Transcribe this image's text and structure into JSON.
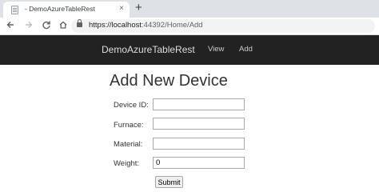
{
  "browser": {
    "tab_title": "- DemoAzureTableRest",
    "close_glyph": "×",
    "new_tab_glyph": "+",
    "url_host": "https://localhost",
    "url_rest": ":44392/Home/Add",
    "icons": [
      "back-arrow-icon",
      "forward-arrow-icon",
      "reload-icon",
      "home-icon",
      "lock-icon",
      "favicon-icon"
    ]
  },
  "navbar": {
    "brand": "DemoAzureTableRest",
    "links": [
      "View",
      "Add"
    ],
    "background": "#222222"
  },
  "form": {
    "heading": "Add New Device",
    "fields": [
      {
        "label": "Device ID:",
        "value": ""
      },
      {
        "label": "Furnace:",
        "value": ""
      },
      {
        "label": "Material:",
        "value": ""
      },
      {
        "label": "Weight:",
        "value": "0"
      }
    ],
    "submit_label": "Submit"
  }
}
